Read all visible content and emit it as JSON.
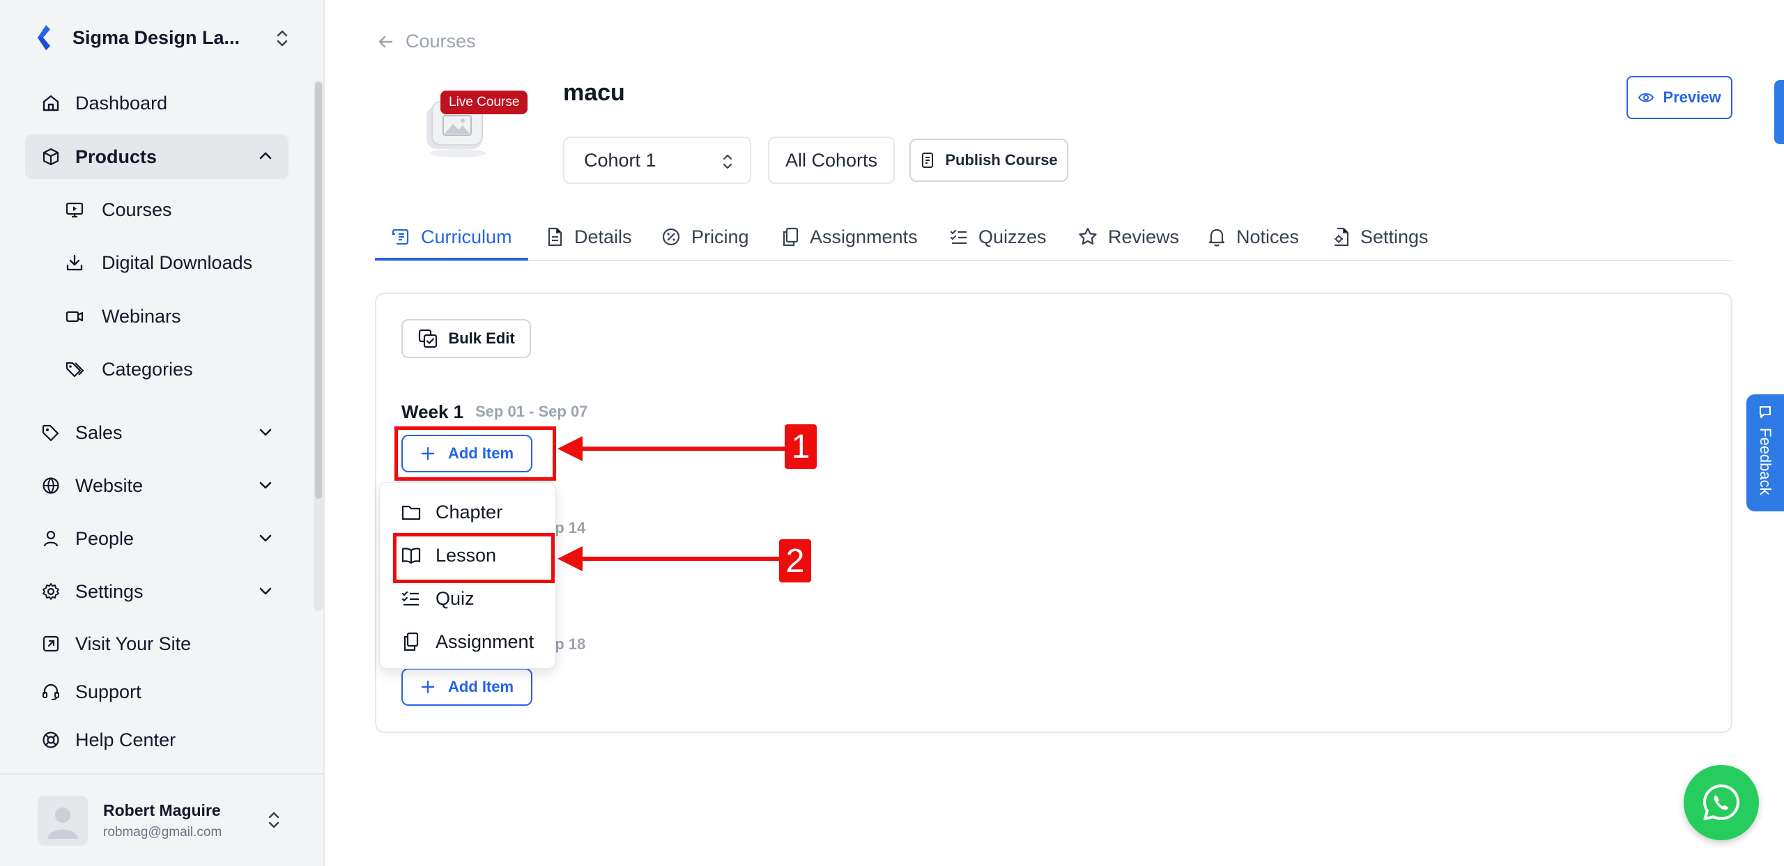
{
  "sidebar": {
    "workspace_name": "Sigma Design La...",
    "nav": {
      "dashboard": "Dashboard",
      "products": "Products",
      "courses": "Courses",
      "digital_downloads": "Digital Downloads",
      "webinars": "Webinars",
      "categories": "Categories",
      "sales": "Sales",
      "website": "Website",
      "people": "People",
      "settings": "Settings",
      "visit_site": "Visit Your Site",
      "support": "Support",
      "help_center": "Help Center"
    },
    "user": {
      "name": "Robert Maguire",
      "email": "robmag@gmail.com"
    }
  },
  "header": {
    "back_label": "Courses",
    "badge": "Live Course",
    "title": "macu",
    "cohort_select": "Cohort 1",
    "all_cohorts": "All Cohorts",
    "publish": "Publish Course",
    "preview": "Preview"
  },
  "tabs": {
    "curriculum": "Curriculum",
    "details": "Details",
    "pricing": "Pricing",
    "assignments": "Assignments",
    "quizzes": "Quizzes",
    "reviews": "Reviews",
    "notices": "Notices",
    "settings": "Settings",
    "active": "Curriculum"
  },
  "curriculum": {
    "bulk_edit": "Bulk Edit",
    "week1": {
      "title": "Week 1",
      "dates": "Sep 01 - Sep 07"
    },
    "week2_partial_date": "ep 14",
    "week3_partial_date": "ep 18",
    "add_item": "Add Item",
    "menu": {
      "chapter": "Chapter",
      "lesson": "Lesson",
      "quiz": "Quiz",
      "assignment": "Assignment"
    }
  },
  "annotations": {
    "step1": "1",
    "step2": "2",
    "color": "#ee0d0d"
  },
  "feedback": "Feedback",
  "colors": {
    "accent": "#2563eb",
    "live_badge": "#c0121e",
    "whatsapp": "#27cc5f"
  }
}
